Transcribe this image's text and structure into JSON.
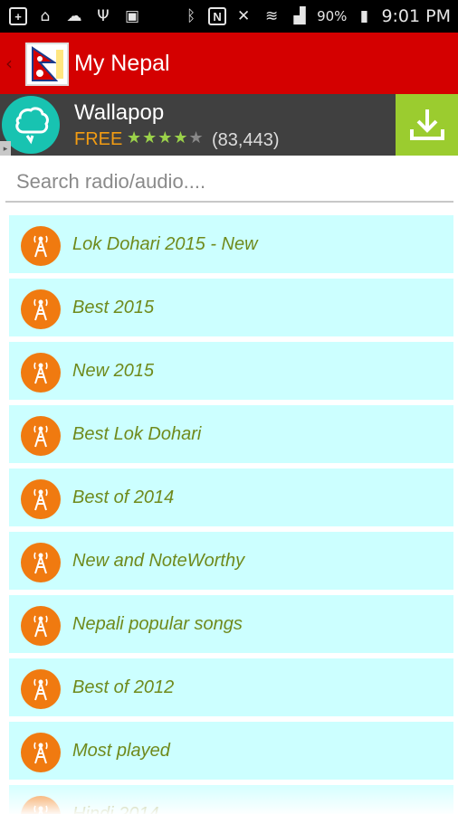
{
  "status_bar": {
    "battery": "90%",
    "time": "9:01 PM"
  },
  "app": {
    "title": "My Nepal"
  },
  "ad": {
    "name": "Wallapop",
    "price": "FREE",
    "rating": 4,
    "rating_count": "(83,443)"
  },
  "search": {
    "placeholder": "Search radio/audio....",
    "value": ""
  },
  "list": {
    "items": [
      {
        "label": "Lok Dohari 2015 - New"
      },
      {
        "label": "Best 2015"
      },
      {
        "label": "New 2015"
      },
      {
        "label": "Best Lok Dohari"
      },
      {
        "label": "Best of 2014"
      },
      {
        "label": "New and NoteWorthy"
      },
      {
        "label": "Nepali popular songs"
      },
      {
        "label": "Best of 2012"
      },
      {
        "label": "Most played"
      },
      {
        "label": "Hindi 2014"
      }
    ]
  },
  "colors": {
    "action_bar": "#d40000",
    "list_item_bg": "#ccffff",
    "list_text": "#6f8a1c",
    "ad_download": "#9bcc2f"
  }
}
